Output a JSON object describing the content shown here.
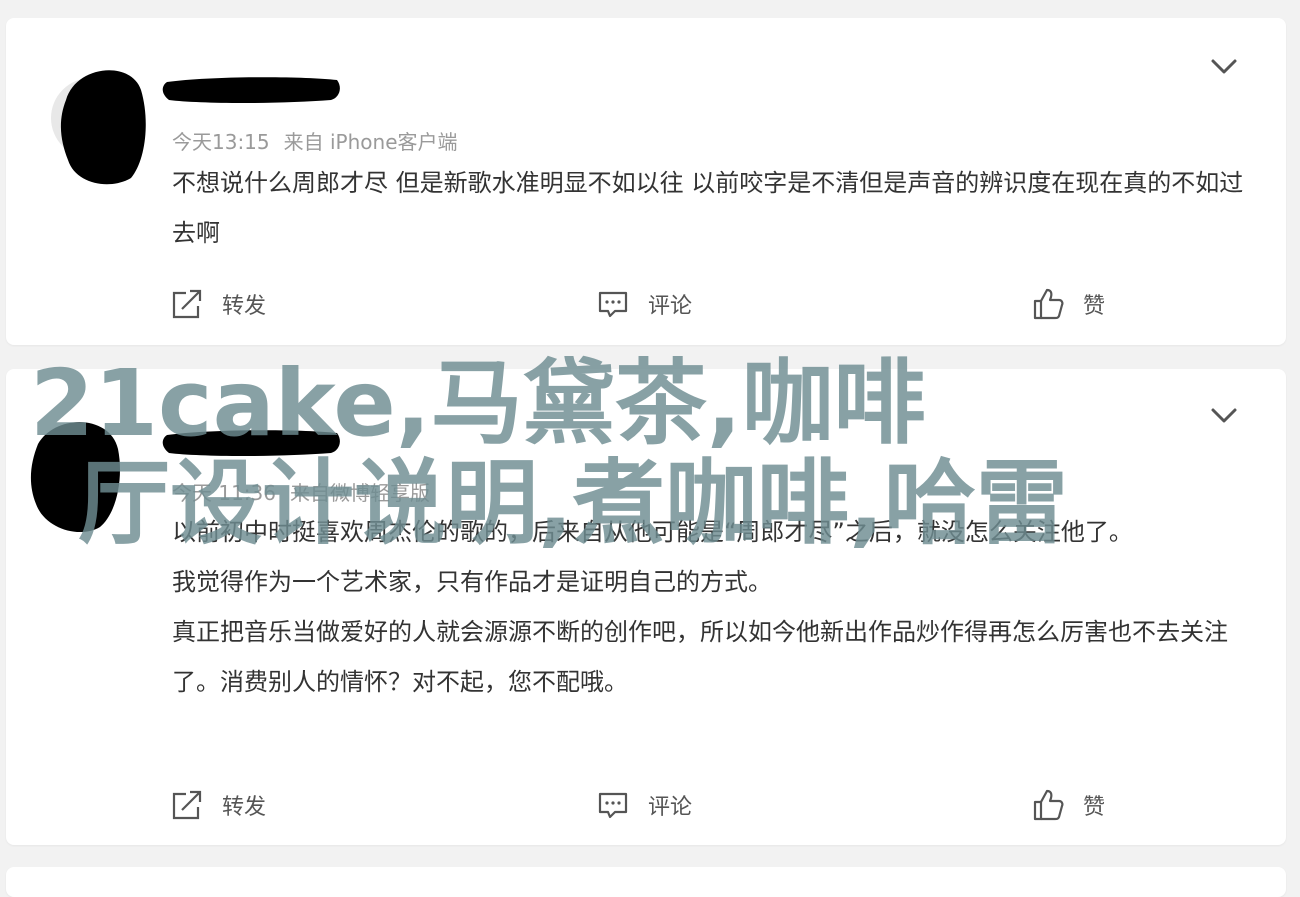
{
  "posts": [
    {
      "timestamp": "今天13:15",
      "source": "来自 iPhone客户端",
      "content": [
        "不想说什么周郎才尽 但是新歌水准明显不如以往 以前咬字是不清但是声音的辨识度在现在真的不如过去啊"
      ],
      "actions": {
        "share": "转发",
        "comment": "评论",
        "like": "赞"
      }
    },
    {
      "timestamp": "今天 11:36",
      "source": "来自微博轻享版",
      "content": [
        "以前初中时挺喜欢周杰伦的歌的，后来自从他可能是“周郎才尽”之后，就没怎么关注他了。",
        "我觉得作为一个艺术家，只有作品才是证明自己的方式。",
        "真正把音乐当做爱好的人就会源源不断的创作吧，所以如今他新出作品炒作得再怎么厉害也不去关注了。消费别人的情怀？对不起，您不配哦。"
      ],
      "actions": {
        "share": "转发",
        "comment": "评论",
        "like": "赞"
      }
    }
  ],
  "overlay": {
    "line1": "21cake,马黛茶,咖啡",
    "line2": "厅设计说明,煮咖啡,哈雷"
  },
  "colors": {
    "background": "#f2f2f2",
    "card": "#ffffff",
    "meta_text": "#9a9a9a",
    "overlay_text": "#6e8c91"
  }
}
